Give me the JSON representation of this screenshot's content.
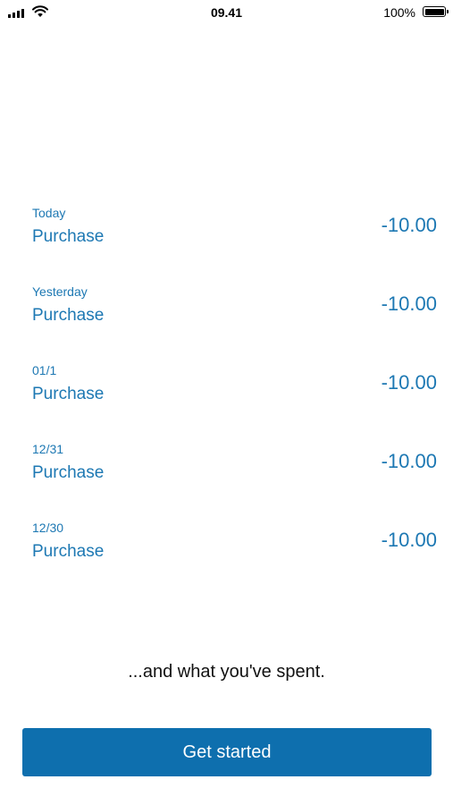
{
  "status_bar": {
    "time": "09.41",
    "battery_percent": "100%",
    "signal_icon": "signal-bars-icon",
    "wifi_icon": "wifi-icon",
    "battery_icon": "battery-icon"
  },
  "transactions": [
    {
      "date": "Today",
      "label": "Purchase",
      "amount": "-10.00"
    },
    {
      "date": "Yesterday",
      "label": "Purchase",
      "amount": "-10.00"
    },
    {
      "date": "01/1",
      "label": "Purchase",
      "amount": "-10.00"
    },
    {
      "date": "12/31",
      "label": "Purchase",
      "amount": "-10.00"
    },
    {
      "date": "12/30",
      "label": "Purchase",
      "amount": "-10.00"
    }
  ],
  "caption": "...and what you've spent.",
  "cta": {
    "label": "Get started"
  },
  "colors": {
    "accent_text": "#1d78b3",
    "button_bg": "#0e6fae",
    "button_text": "#ffffff"
  }
}
